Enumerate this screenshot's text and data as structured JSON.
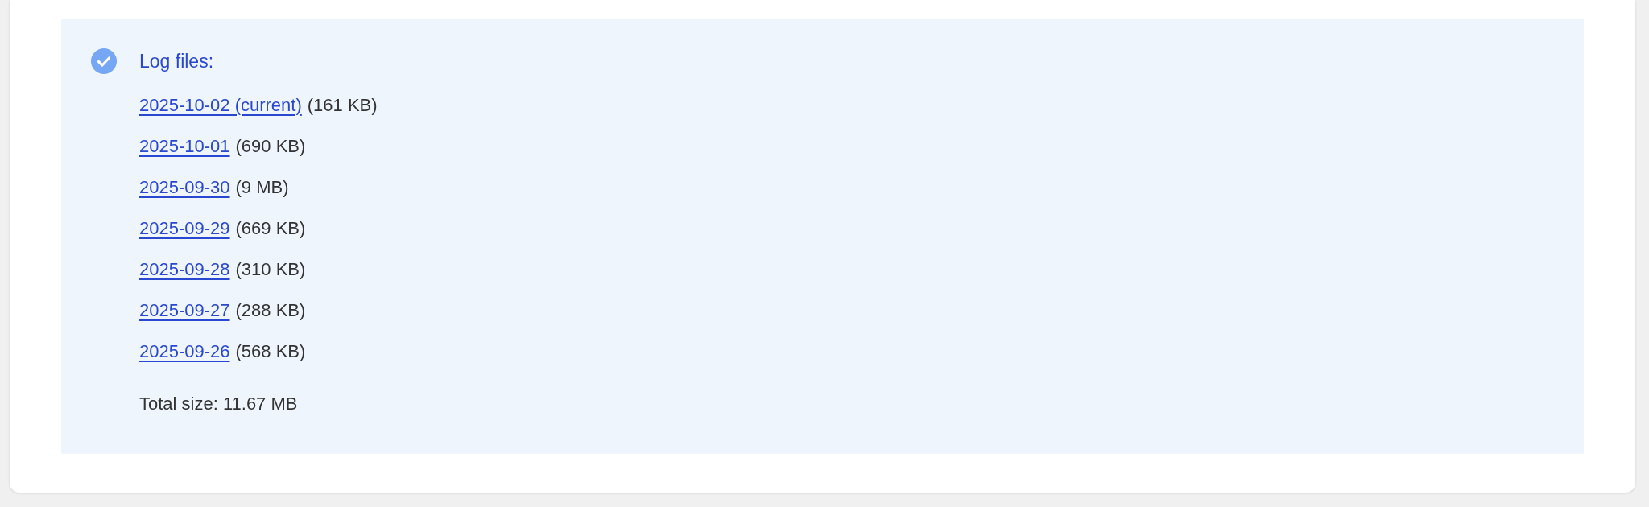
{
  "log_panel": {
    "title": "Log files:",
    "files": [
      {
        "date": "2025-10-02 (current)",
        "size": "(161 KB)"
      },
      {
        "date": "2025-10-01",
        "size": "(690 KB)"
      },
      {
        "date": "2025-09-30",
        "size": "(9 MB)"
      },
      {
        "date": "2025-09-29",
        "size": "(669 KB)"
      },
      {
        "date": "2025-09-28",
        "size": "(310 KB)"
      },
      {
        "date": "2025-09-27",
        "size": "(288 KB)"
      },
      {
        "date": "2025-09-26",
        "size": "(568 KB)"
      }
    ],
    "total": "Total size: 11.67 MB"
  }
}
